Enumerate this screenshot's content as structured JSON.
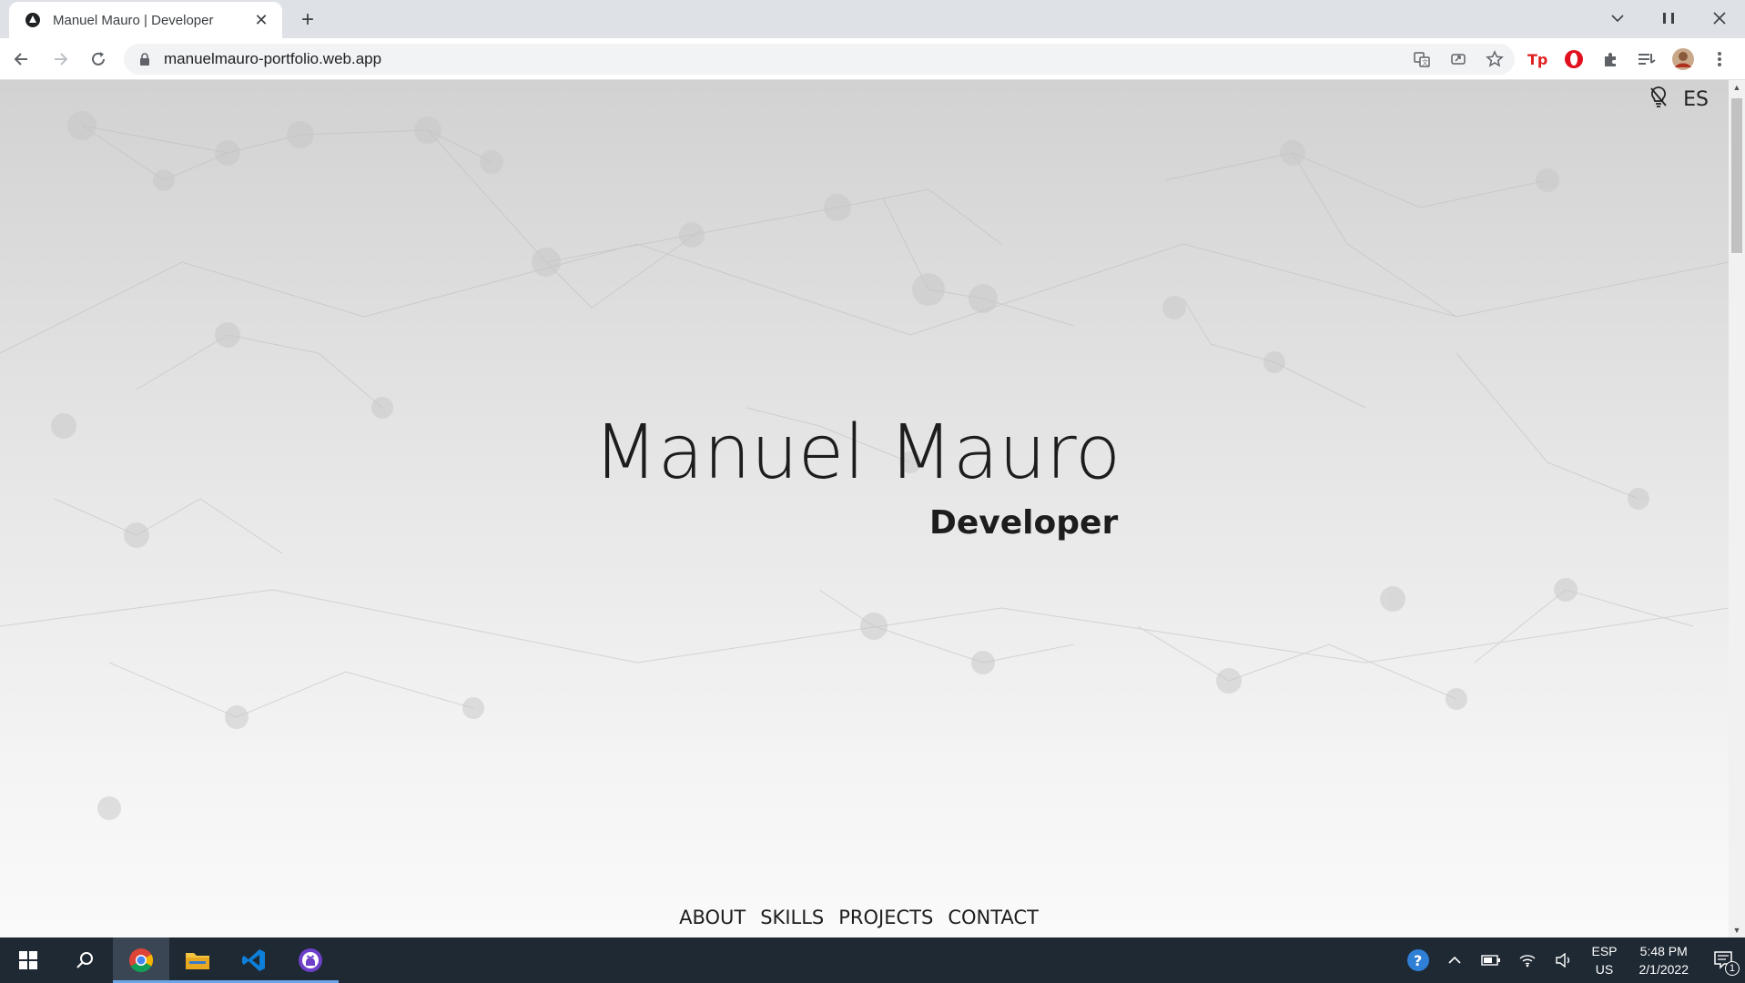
{
  "browser": {
    "tab_title": "Manuel Mauro | Developer",
    "url": "manuelmauro-portfolio.web.app",
    "new_tab_label": "+"
  },
  "page": {
    "lang_toggle": "ES",
    "name": "Manuel Mauro",
    "role": "Developer",
    "nav": [
      "ABOUT",
      "SKILLS",
      "PROJECTS",
      "CONTACT"
    ]
  },
  "taskbar": {
    "lang_top": "ESP",
    "lang_bottom": "US",
    "time": "5:48 PM",
    "date": "2/1/2022",
    "notification_count": "1"
  },
  "colors": {
    "taskbar_bg": "#1f2933",
    "accent_blue": "#6aa6e6",
    "text_dark": "#1d1d1d"
  }
}
